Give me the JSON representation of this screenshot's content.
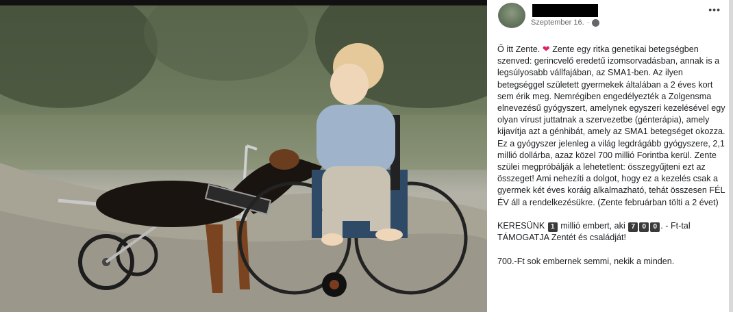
{
  "post": {
    "date": "Szeptember 16.",
    "more_label": "•••",
    "p1_a": "Ő itt Zente. ",
    "p1_b": " Zente egy ritka genetikai betegségben szenved: gerincvelő eredetű izomsorvadásban, annak is a legsúlyosabb vállfajában, az SMA1-ben. Az ilyen betegséggel született gyermekek általában a 2 éves kort sem érik meg. Nemrégiben engedélyezték a Zolgensma elnevezésű gyógyszert, amelynek egyszeri kezelésével egy olyan vírust juttatnak a szervezetbe (génterápia), amely kijavítja azt a génhibát, amely az SMA1 betegséget okozza. Ez a gyógyszer jelenleg a világ legdrágább gyógyszere, 2,1 millió dollárba, azaz közel 700 millió Forintba kerül. Zente szülei megpróbálják a lehetetlent: összegyűjteni ezt az összeget! Ami nehezíti a dolgot, hogy ez a kezelés csak a gyermek két éves koráig alkalmazható, tehát összesen FÉL ÉV áll a rendelkezésükre. (Zente februárban tölti a 2 évet)",
    "p2_a": "KERESÜNK ",
    "p2_num1": "1",
    "p2_b": " millió embert, aki ",
    "p2_num2": "7",
    "p2_num3": "0",
    "p2_num4": "0",
    "p2_c": ". - Ft-tal TÁMOGATJA Zentét és családját!",
    "p3": "700.-Ft sok embernek semmi, nekik a minden."
  },
  "icons": {
    "heart": "heart-icon",
    "globe": "globe-icon",
    "more": "more-options-icon"
  },
  "colors": {
    "heart": "#e0245e",
    "meta_text": "#65676b"
  }
}
